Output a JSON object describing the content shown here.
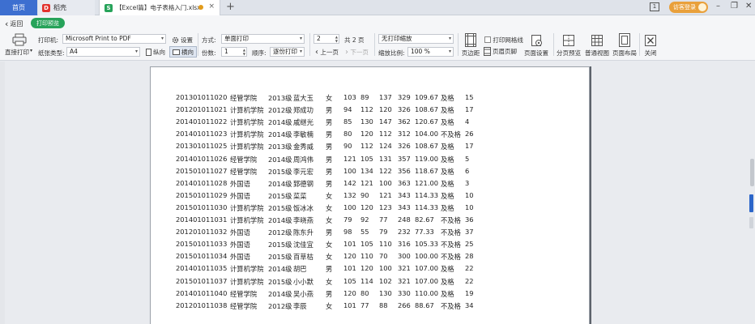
{
  "tabs": {
    "home": "首页",
    "docker": "稻壳",
    "docker_logo": "D",
    "document": "【Excel篇】电子表格入门.xlsx",
    "document_logo": "S",
    "close_glyph": "×",
    "new_tab_glyph": "+"
  },
  "window": {
    "login_label": "访客登录",
    "count_badge": "1",
    "minimize_glyph": "–",
    "restore_glyph": "❐",
    "close_glyph": "✕"
  },
  "ribbon": {
    "back_label": "返回",
    "mode_tab": "打印预览",
    "print_direct": "直接打印",
    "printer_label": "打印机:",
    "printer_value": "Microsoft Print to PDF",
    "settings_label": "设置",
    "method_label": "方式:",
    "method_value": "单面打印",
    "page_value": "2",
    "page_total": "共 2 页",
    "scale_mode_value": "无打印缩放",
    "paper_label": "纸张类型:",
    "paper_value": "A4",
    "portrait_label": "纵向",
    "landscape_label": "横向",
    "copies_label": "份数:",
    "copies_value": "1",
    "order_label": "顺序:",
    "order_value": "逐份打印",
    "prev_page": "上一页",
    "next_page": "下一页",
    "zoom_label": "缩放比例:",
    "zoom_value": "100 %",
    "margins_btn": "页边距",
    "gridlines_check": "打印网格线",
    "header_footer_btn": "页眉页脚",
    "page_setup_btn": "页面设置",
    "page_break_btn": "分页预览",
    "normal_view_btn": "普通视图",
    "page_layout_btn": "页面布局",
    "close_btn": "关闭",
    "dropdown_glyph": "▾",
    "back_glyph": "‹",
    "prev_glyph": "‹",
    "next_glyph": "›",
    "spin_up_glyph": "▲",
    "spin_down_glyph": "▼"
  },
  "table": {
    "rows": [
      [
        "201301011020",
        "经管学院",
        "2013级",
        "蓝大玉",
        "女",
        "103",
        "89",
        "137",
        "329",
        "109.67",
        "及格",
        "15"
      ],
      [
        "201201011021",
        "计算机学院",
        "2012级",
        "郑成功",
        "男",
        "94",
        "112",
        "120",
        "326",
        "108.67",
        "及格",
        "17"
      ],
      [
        "201401011022",
        "计算机学院",
        "2014级",
        "戚继光",
        "男",
        "85",
        "130",
        "147",
        "362",
        "120.67",
        "及格",
        "4"
      ],
      [
        "201401011023",
        "计算机学院",
        "2014级",
        "李敏楠",
        "男",
        "80",
        "120",
        "112",
        "312",
        "104.00",
        "不及格",
        "26"
      ],
      [
        "201301011025",
        "计算机学院",
        "2013级",
        "金秀威",
        "男",
        "90",
        "112",
        "124",
        "326",
        "108.67",
        "及格",
        "17"
      ],
      [
        "201401011026",
        "经管学院",
        "2014级",
        "周鸿伟",
        "男",
        "121",
        "105",
        "131",
        "357",
        "119.00",
        "及格",
        "5"
      ],
      [
        "201501011027",
        "经管学院",
        "2015级",
        "李元宏",
        "男",
        "100",
        "134",
        "122",
        "356",
        "118.67",
        "及格",
        "6"
      ],
      [
        "201401011028",
        "外国语",
        "2014级",
        "郅德钢",
        "男",
        "142",
        "121",
        "100",
        "363",
        "121.00",
        "及格",
        "3"
      ],
      [
        "201501011029",
        "外国语",
        "2015级",
        "菜菜",
        "女",
        "132",
        "90",
        "121",
        "343",
        "114.33",
        "及格",
        "10"
      ],
      [
        "201501011030",
        "计算机学院",
        "2015级",
        "饭冰冰",
        "女",
        "100",
        "120",
        "123",
        "343",
        "114.33",
        "及格",
        "10"
      ],
      [
        "201401011031",
        "计算机学院",
        "2014级",
        "李晓燕",
        "女",
        "79",
        "92",
        "77",
        "248",
        "82.67",
        "不及格",
        "36"
      ],
      [
        "201201011032",
        "外国语",
        "2012级",
        "陈东升",
        "男",
        "98",
        "55",
        "79",
        "232",
        "77.33",
        "不及格",
        "37"
      ],
      [
        "201501011033",
        "外国语",
        "2015级",
        "沈佳宜",
        "女",
        "101",
        "105",
        "110",
        "316",
        "105.33",
        "不及格",
        "25"
      ],
      [
        "201501011034",
        "外国语",
        "2015级",
        "百草枯",
        "女",
        "120",
        "110",
        "70",
        "300",
        "100.00",
        "不及格",
        "28"
      ],
      [
        "201401011035",
        "计算机学院",
        "2014级",
        "胡巴",
        "男",
        "101",
        "120",
        "100",
        "321",
        "107.00",
        "及格",
        "22"
      ],
      [
        "201501011037",
        "计算机学院",
        "2015级",
        "小小默",
        "女",
        "105",
        "114",
        "102",
        "321",
        "107.00",
        "及格",
        "22"
      ],
      [
        "201401011040",
        "经管学院",
        "2014级",
        "吴小燕",
        "男",
        "120",
        "80",
        "130",
        "330",
        "110.00",
        "及格",
        "19"
      ],
      [
        "201201011038",
        "经管学院",
        "2012级",
        "李辰",
        "女",
        "101",
        "77",
        "88",
        "266",
        "88.67",
        "不及格",
        "34"
      ]
    ]
  }
}
